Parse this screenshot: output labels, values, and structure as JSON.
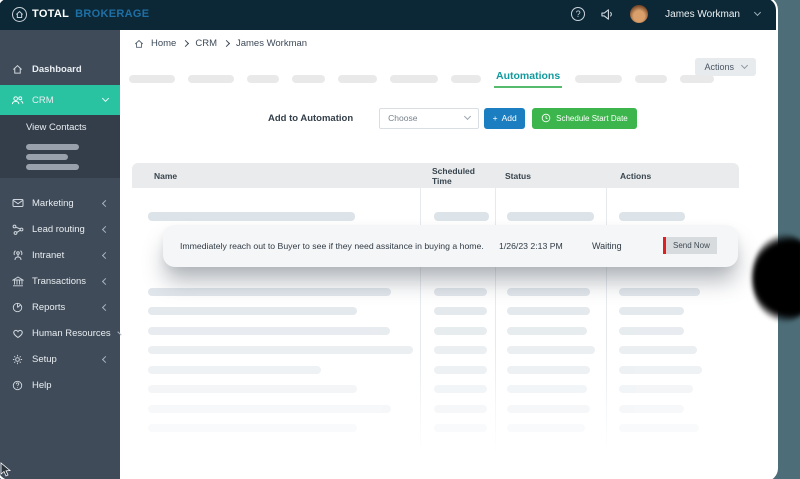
{
  "topbar": {
    "logo_total": "TOTAL",
    "logo_brokerage": "BROKERAGE",
    "help_glyph": "?",
    "user_name": "James Workman"
  },
  "breadcrumb": {
    "items": [
      "Home",
      "CRM",
      "James Workman"
    ]
  },
  "actions_button": {
    "label": "Actions"
  },
  "tabs": {
    "active_label": "Automations",
    "skeleton_before": [
      46,
      46,
      32,
      33,
      39,
      48,
      30
    ],
    "skeleton_after": [
      47,
      32,
      34
    ]
  },
  "toolbar": {
    "label": "Add to Automation",
    "select_value": "Choose",
    "add_plus": "+",
    "add_label": "Add",
    "schedule_label": "Schedule Start Date"
  },
  "sidebar": {
    "items": [
      {
        "label": "Dashboard",
        "icon": "home-icon"
      },
      {
        "label": "CRM",
        "icon": "people-icon",
        "active": true
      },
      {
        "label": "View Contacts",
        "type": "subitem"
      },
      {
        "label": "Marketing",
        "icon": "envelope-icon"
      },
      {
        "label": "Lead routing",
        "icon": "network-icon"
      },
      {
        "label": "Intranet",
        "icon": "intranet-icon"
      },
      {
        "label": "Transactions",
        "icon": "bank-icon"
      },
      {
        "label": "Reports",
        "icon": "pie-chart-icon"
      },
      {
        "label": "Human Resources",
        "icon": "heart-icon"
      },
      {
        "label": "Setup",
        "icon": "gear-icon"
      },
      {
        "label": "Help",
        "icon": "question-icon"
      }
    ],
    "skeleton_widths": [
      53,
      42,
      53
    ]
  },
  "table": {
    "columns": [
      "Name",
      "Scheduled Time",
      "Status",
      "Actions"
    ],
    "highlight_row": {
      "name": "Immediately reach out to Buyer to see if they need assitance in buying a home.",
      "scheduled_time": "1/26/23 2:13 PM",
      "status": "Waiting",
      "action_label": "Send Now"
    },
    "skeleton_top_row": {
      "name": 207,
      "scheduled": 55,
      "status": 87,
      "actions": 66
    },
    "skeleton_rows": [
      {
        "name": 243,
        "scheduled": 53,
        "status": 83,
        "actions": 81,
        "opacity": 0.85
      },
      {
        "name": 209,
        "scheduled": 53,
        "status": 83,
        "actions": 65,
        "opacity": 0.75
      },
      {
        "name": 242,
        "scheduled": 53,
        "status": 80,
        "actions": 65,
        "opacity": 0.65
      },
      {
        "name": 265,
        "scheduled": 53,
        "status": 88,
        "actions": 78,
        "opacity": 0.55
      },
      {
        "name": 173,
        "scheduled": 53,
        "status": 83,
        "actions": 83,
        "opacity": 0.45
      },
      {
        "name": 209,
        "scheduled": 53,
        "status": 80,
        "actions": 74,
        "opacity": 0.34
      },
      {
        "name": 243,
        "scheduled": 53,
        "status": 83,
        "actions": 65,
        "opacity": 0.24
      },
      {
        "name": 209,
        "scheduled": 53,
        "status": 78,
        "actions": 80,
        "opacity": 0.16
      }
    ]
  },
  "colors": {
    "topbar_bg": "#0c2836",
    "sidebar_bg": "#3f4b59",
    "sidebar_active": "#2ac3a2",
    "brand_blue": "#1e6fa5",
    "tab_teal": "#129a9e",
    "tab_underline_green": "#57bb6e",
    "button_blue": "#1b7ec1",
    "button_green": "#3cb64c",
    "send_now_red": "#e02020",
    "background_strip": "#4d6e78"
  }
}
